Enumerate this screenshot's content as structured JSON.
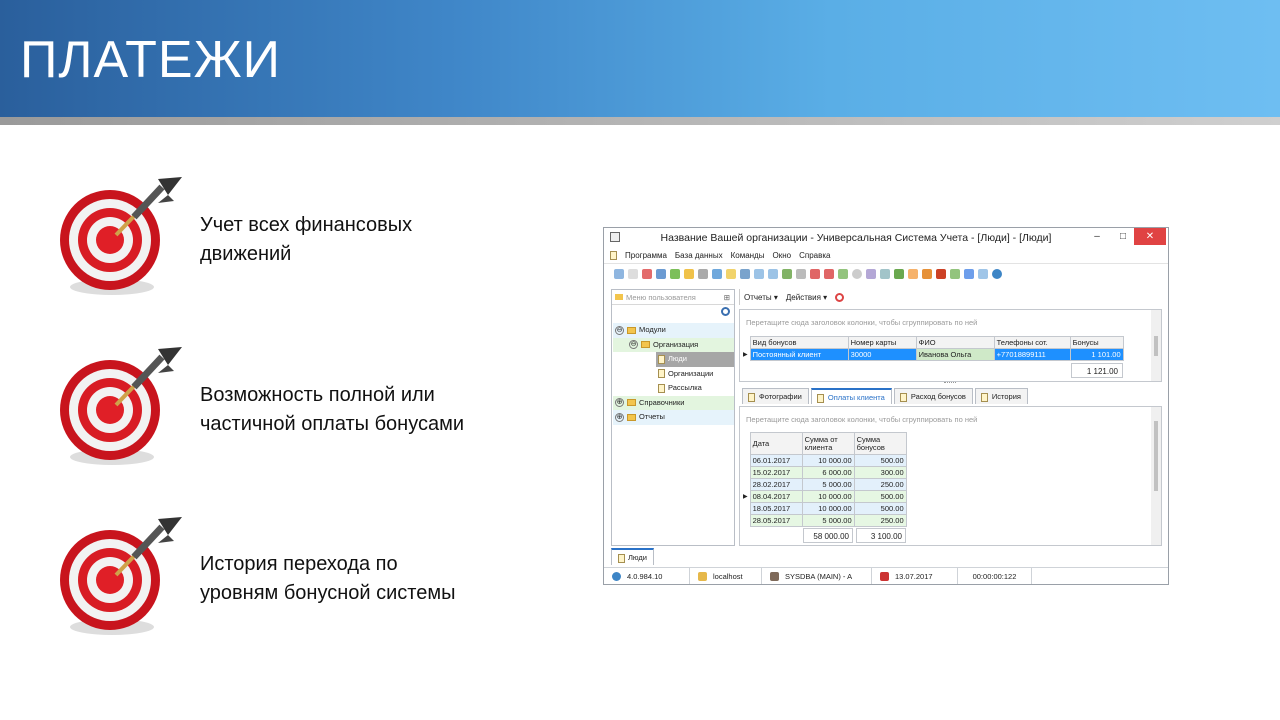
{
  "slide": {
    "title": "ПЛАТЕЖИ",
    "bullets": [
      {
        "icon": "target-dart-icon",
        "lines": [
          "Учет всех финансовых",
          "движений"
        ]
      },
      {
        "icon": "target-dart-icon",
        "lines": [
          "Возможность полной или",
          "частичной оплаты бонусами"
        ]
      },
      {
        "icon": "target-dart-icon",
        "lines": [
          "История перехода по",
          "уровням бонусной системы"
        ]
      }
    ]
  },
  "app": {
    "title": "Название Вашей организации - Универсальная Система Учета - [Люди] - [Люди]",
    "window_controls": {
      "minimize": "–",
      "maximize": "□",
      "close": "✕"
    },
    "menu": [
      "Программа",
      "База данных",
      "Команды",
      "Окно",
      "Справка"
    ],
    "side_menu": {
      "header": "Меню пользователя",
      "tree": [
        {
          "label": "Модули",
          "level": 0,
          "type": "folder",
          "expander": "⊖"
        },
        {
          "label": "Организация",
          "level": 1,
          "type": "folder",
          "expander": "⊖"
        },
        {
          "label": "Люди",
          "level": 2,
          "type": "doc",
          "selected": true
        },
        {
          "label": "Организации",
          "level": 2,
          "type": "doc"
        },
        {
          "label": "Рассылка",
          "level": 2,
          "type": "doc"
        },
        {
          "label": "Справочники",
          "level": 0,
          "type": "folder",
          "expander": "⊕"
        },
        {
          "label": "Отчеты",
          "level": 0,
          "type": "folder",
          "expander": "⊕"
        }
      ]
    },
    "main_toolbar": {
      "reports": "Отчеты ▾",
      "actions": "Действия ▾"
    },
    "group_hint": "Перетащите сюда заголовок колонки, чтобы сгруппировать по ней",
    "top_grid": {
      "columns": [
        "Вид бонусов",
        "Номер карты",
        "ФИО",
        "Телефоны сот.",
        "Бонусы"
      ],
      "rows": [
        [
          "Постоянный клиент",
          "30000",
          "Иванова Ольга",
          "+77018899111",
          "1 101.00"
        ]
      ],
      "footer": "1 121.00"
    },
    "tabs": [
      "Фотографии",
      "Оплаты клиента",
      "Расход бонусов",
      "История"
    ],
    "active_tab": "Оплаты клиента",
    "payments_grid": {
      "columns": [
        "Дата",
        "Сумма от клиента",
        "Сумма бонусов"
      ],
      "rows": [
        [
          "06.01.2017",
          "10 000.00",
          "500.00"
        ],
        [
          "15.02.2017",
          "6 000.00",
          "300.00"
        ],
        [
          "28.02.2017",
          "5 000.00",
          "250.00"
        ],
        [
          "08.04.2017",
          "10 000.00",
          "500.00"
        ],
        [
          "18.05.2017",
          "10 000.00",
          "500.00"
        ],
        [
          "28.05.2017",
          "5 000.00",
          "250.00"
        ]
      ],
      "footer": [
        "58 000.00",
        "3 100.00"
      ]
    },
    "bottom_tab": "Люди",
    "status": {
      "version": "4.0.984.10",
      "server": "localhost",
      "user": "SYSDBA (MAIN) - A",
      "date": "13.07.2017",
      "time": "00:00:00:122"
    }
  }
}
